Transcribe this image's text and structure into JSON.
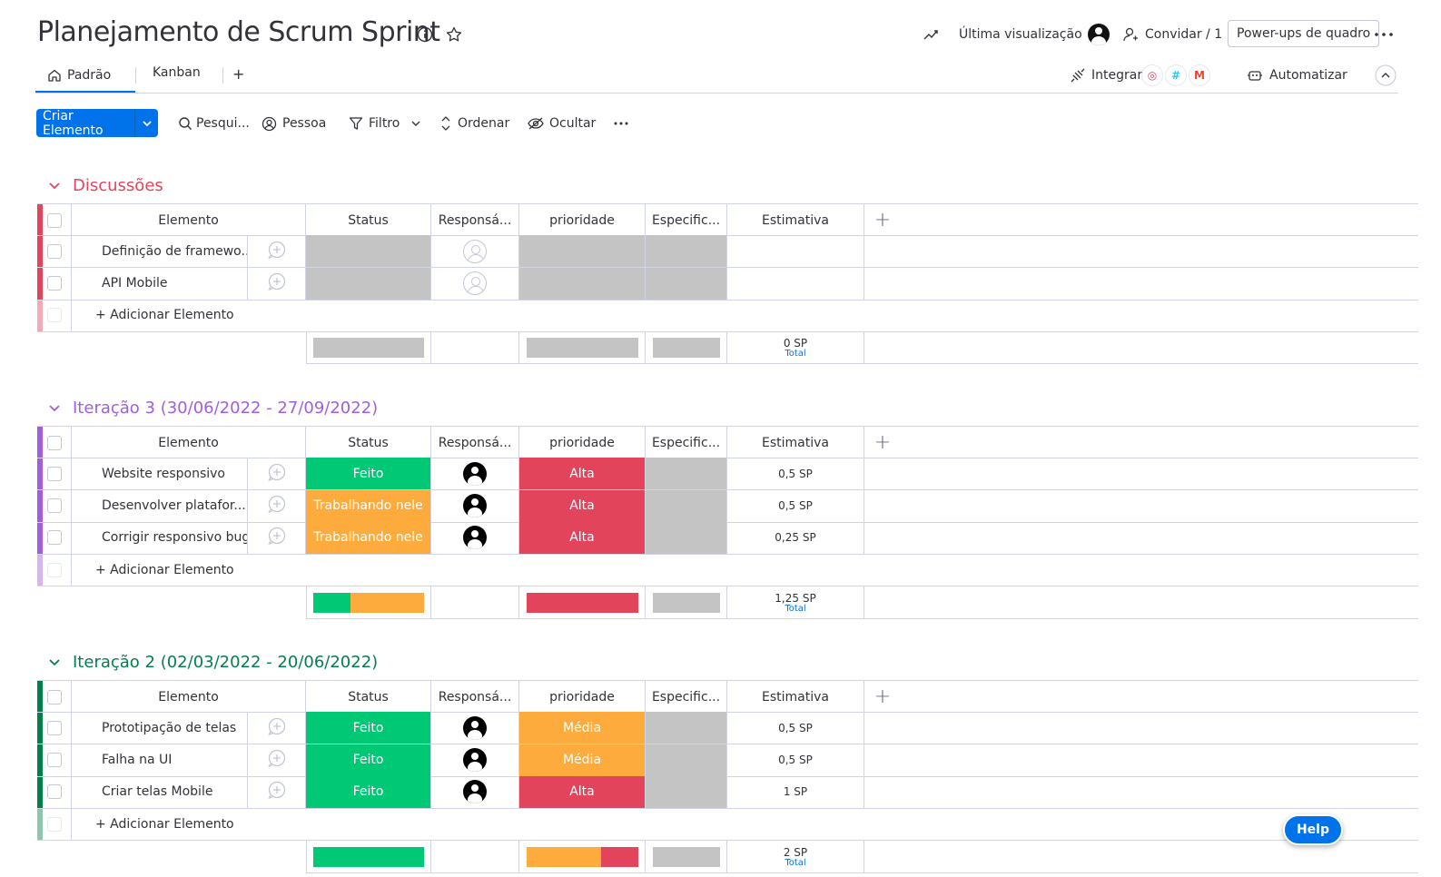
{
  "board": {
    "title": "Planejamento de Scrum Sprint",
    "last_view_label": "Última visualização",
    "invite_label": "Convidar / 1",
    "powerups_label": "Power-ups de quadro",
    "integrate_label": "Integrar",
    "automate_label": "Automatizar"
  },
  "tabs": {
    "main": "Padrão",
    "kanban": "Kanban",
    "add": "+"
  },
  "toolbar": {
    "new_item": "Criar Elemento",
    "search": "Pesqui...",
    "person": "Pessoa",
    "filter": "Filtro",
    "sort": "Ordenar",
    "hide": "Ocultar"
  },
  "columns": {
    "item": "Elemento",
    "status": "Status",
    "owner": "Responsá...",
    "priority": "prioridade",
    "spec": "Especific...",
    "estimate": "Estimativa",
    "add": "+"
  },
  "add_item_label": "+ Adicionar Elemento",
  "total_label": "Total",
  "groups": [
    {
      "title": "Discussões",
      "color": "#e2445c",
      "items": [
        {
          "name": "Definição de framewo...",
          "status": "",
          "priority": "",
          "estimate": ""
        },
        {
          "name": "API Mobile",
          "status": "",
          "priority": "",
          "estimate": ""
        }
      ],
      "total": "0 SP"
    },
    {
      "title": "Iteração 3 (30/06/2022 - 27/09/2022)",
      "color": "#a25ddc",
      "items": [
        {
          "name": "Website responsivo",
          "status": "Feito",
          "priority": "Alta",
          "estimate": "0,5 SP"
        },
        {
          "name": "Desenvolver platafor...",
          "status": "Trabalhando nele",
          "priority": "Alta",
          "estimate": "0,5 SP"
        },
        {
          "name": "Corrigir responsivo bug",
          "status": "Trabalhando nele",
          "priority": "Alta",
          "estimate": "0,25 SP"
        }
      ],
      "total": "1,25 SP"
    },
    {
      "title": "Iteração 2 (02/03/2022 - 20/06/2022)",
      "color": "#037f4c",
      "items": [
        {
          "name": "Prototipação de telas",
          "status": "Feito",
          "priority": "Média",
          "estimate": "0,5 SP"
        },
        {
          "name": "Falha na UI",
          "status": "Feito",
          "priority": "Média",
          "estimate": "0,5 SP"
        },
        {
          "name": "Criar telas Mobile",
          "status": "Feito",
          "priority": "Alta",
          "estimate": "1 SP"
        }
      ],
      "total": "2 SP"
    }
  ],
  "colors": {
    "done": "#00c875",
    "working": "#fdab3d",
    "high": "#e2445c",
    "medium": "#fdab3d",
    "empty": "#c4c4c4",
    "primary": "#0073ea"
  },
  "help_label": "Help"
}
